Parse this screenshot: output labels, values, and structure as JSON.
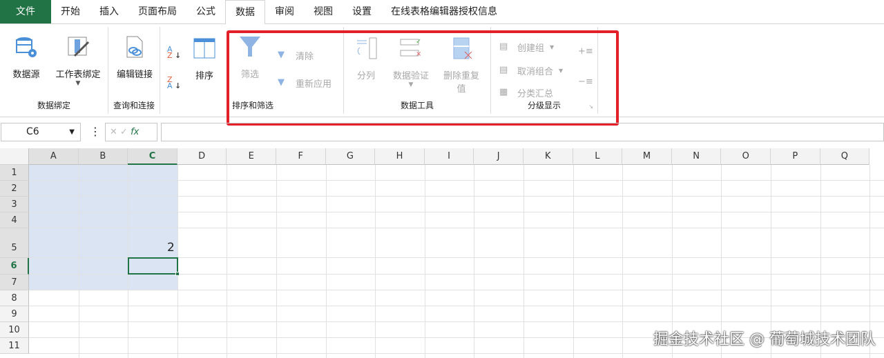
{
  "tabs": [
    "文件",
    "开始",
    "插入",
    "页面布局",
    "公式",
    "数据",
    "审阅",
    "视图",
    "设置",
    "在线表格编辑器授权信息"
  ],
  "active_tab": "数据",
  "ribbon": {
    "g1": {
      "label": "数据绑定",
      "datasource": "数据源",
      "sheetbind": "工作表绑定"
    },
    "g2": {
      "label": "查询和连接",
      "editlink": "编辑链接"
    },
    "g3": {
      "sort": "排序"
    },
    "g4": {
      "label": "排序和筛选",
      "filter": "筛选",
      "clear": "清除",
      "reapply": "重新应用"
    },
    "g5": {
      "label": "数据工具",
      "split": "分列",
      "validate": "数据验证",
      "dedupe1": "删除重复",
      "dedupe2": "值"
    },
    "g6": {
      "label": "分级显示",
      "group": "创建组",
      "ungroup": "取消组合",
      "subtotal": "分类汇总"
    }
  },
  "formula": {
    "namebox": "C6",
    "fx": "fx",
    "value": ""
  },
  "columns": [
    "A",
    "B",
    "C",
    "D",
    "E",
    "F",
    "G",
    "H",
    "I",
    "J",
    "K",
    "L",
    "M",
    "N",
    "O",
    "P",
    "Q"
  ],
  "rows": [
    "1",
    "2",
    "3",
    "4",
    "5",
    "6",
    "7",
    "8",
    "9",
    "10",
    "11"
  ],
  "cells": {
    "C5": "2"
  },
  "active_cell": "C6",
  "selection": "A1:C7",
  "watermark": "掘金技术社区 @ 葡萄城技术团队",
  "colors": {
    "accent": "#217346",
    "highlight": "#e3202a",
    "selection": "#dbe4f2"
  }
}
